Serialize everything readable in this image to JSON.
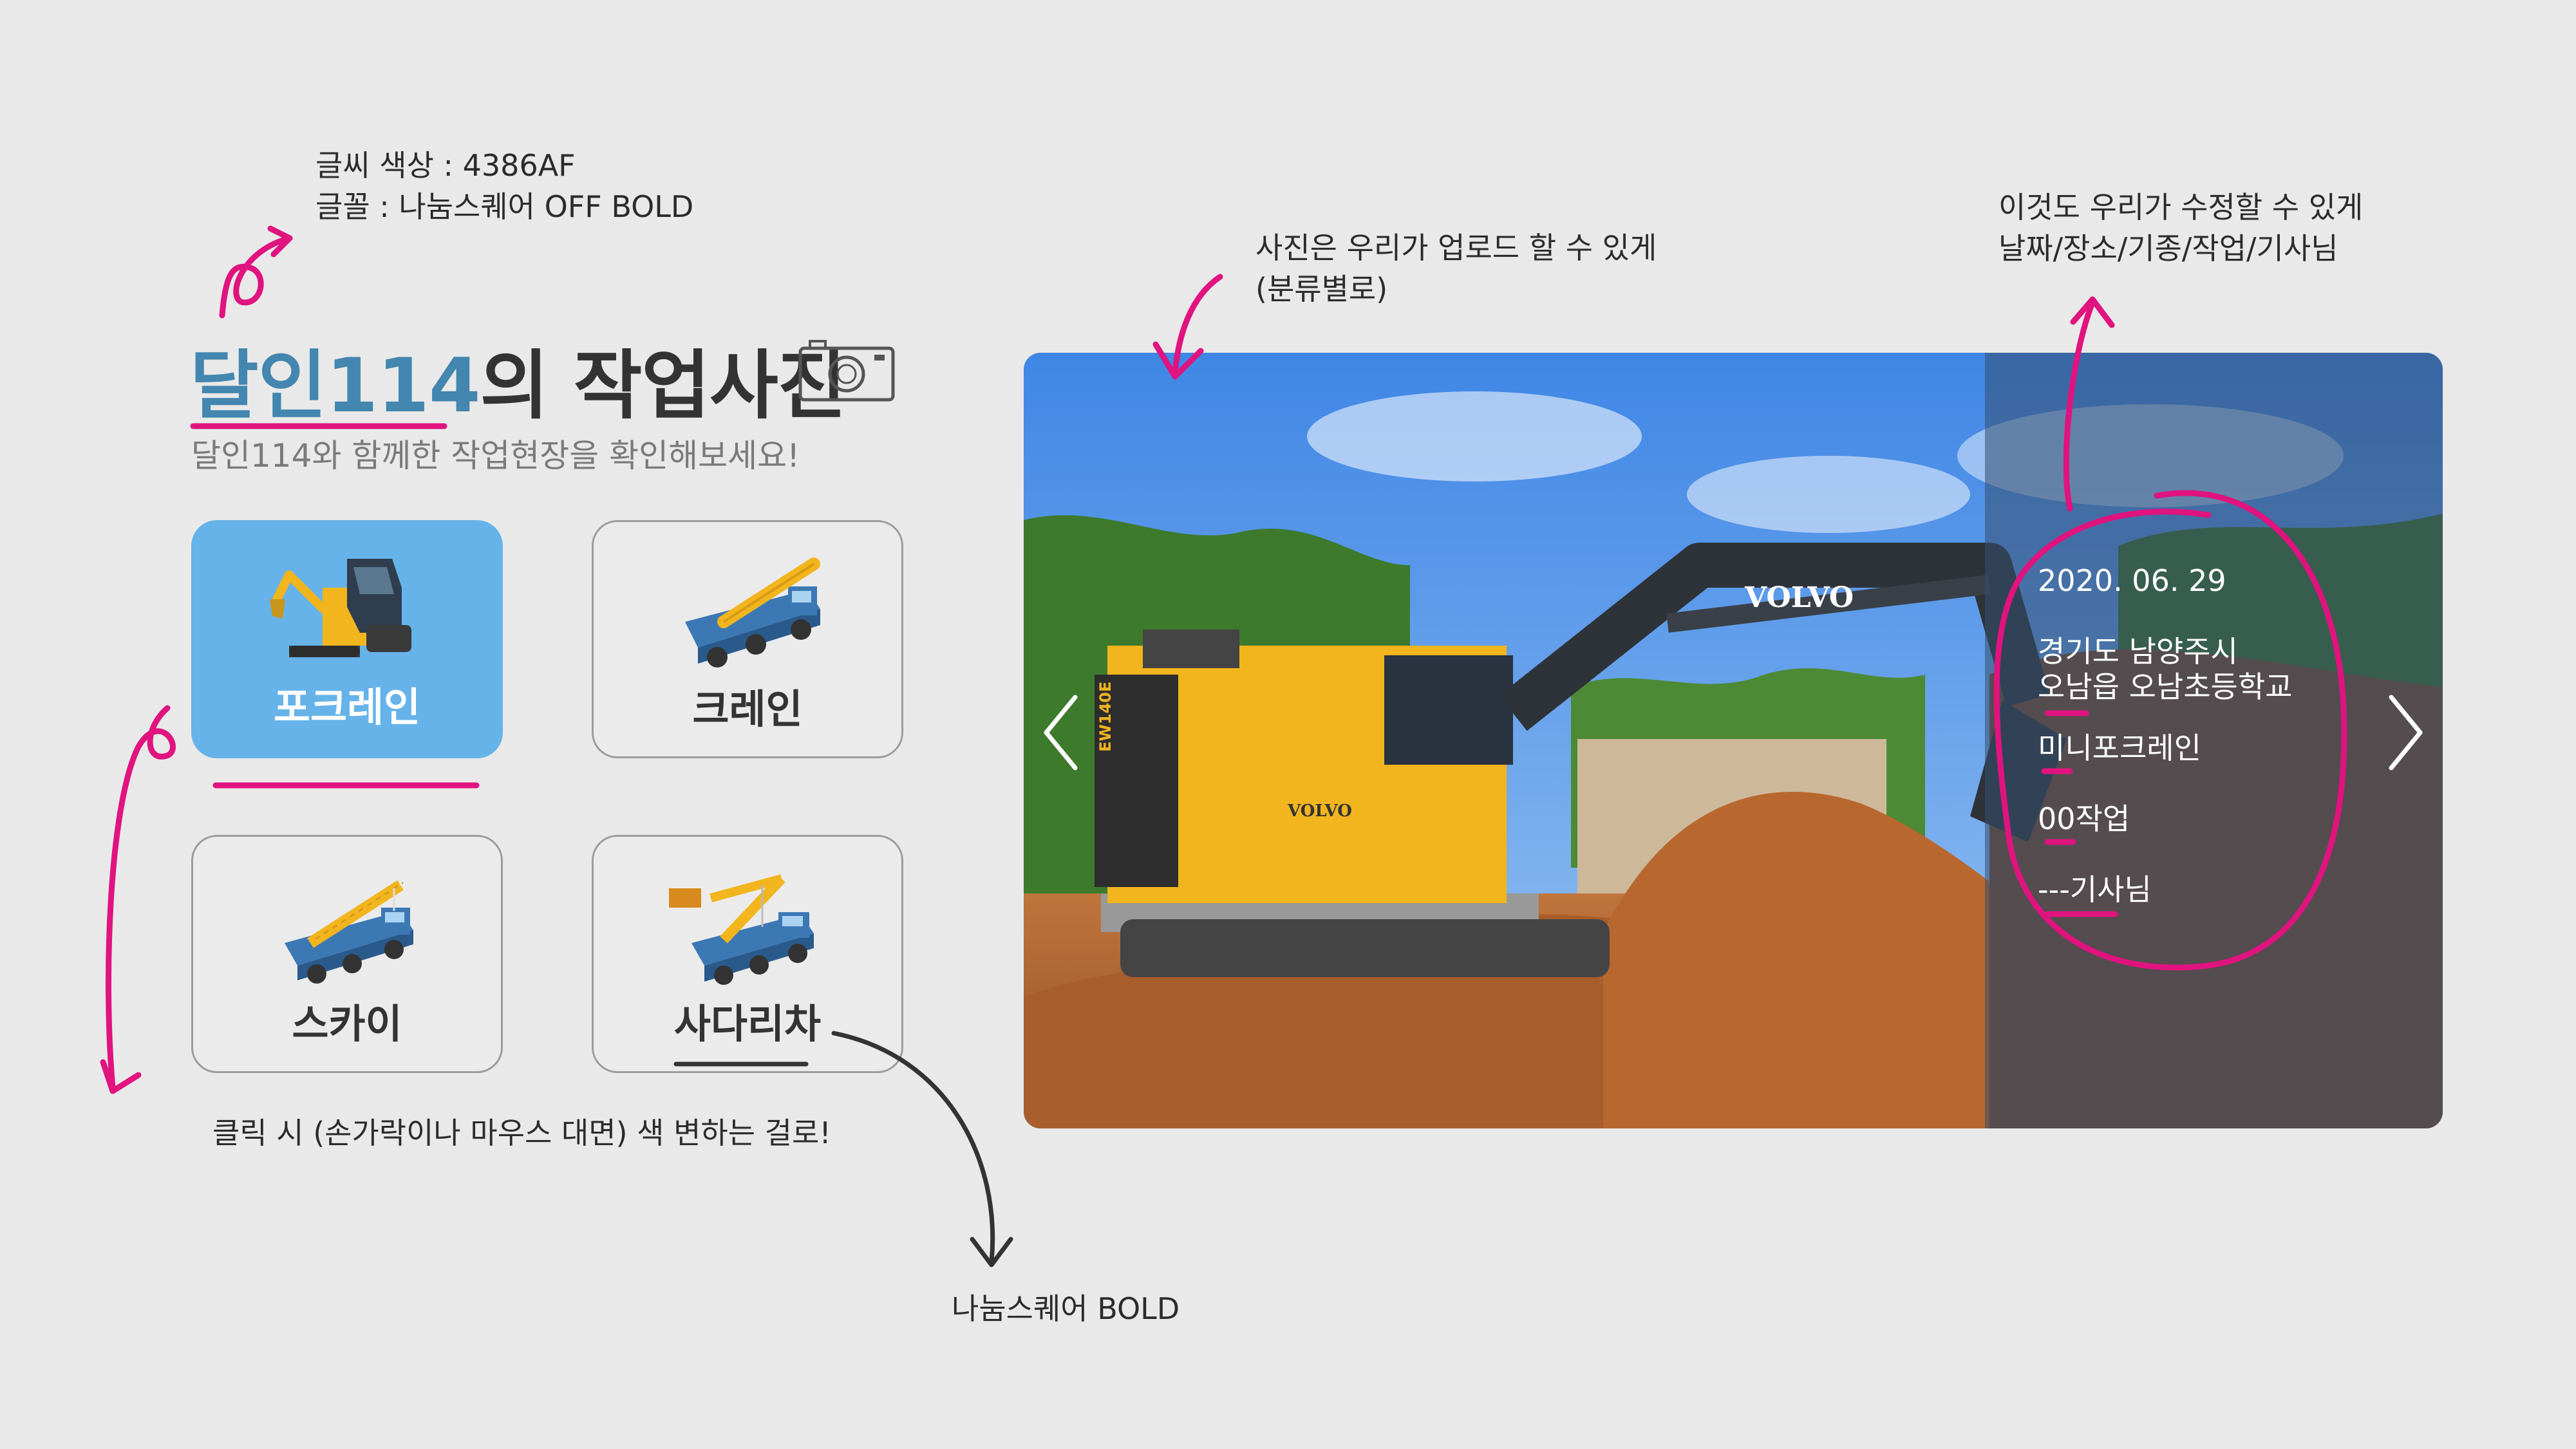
{
  "notes": {
    "font_color_line": "글씨 색상 : 4386AF",
    "font_family_line": "글꼴 : 나눔스퀘어 OFF BOLD",
    "photo_upload_line1": "사진은 우리가 업로드 할 수 있게",
    "photo_upload_line2": "(분류별로)",
    "editable_line1": "이것도 우리가 수정할 수 있게",
    "editable_line2": "날짜/장소/기종/작업/기사님",
    "click_hint": "클릭 시 (손가락이나 마우스 대면) 색 변하는 걸로!",
    "button_font": "나눔스퀘어 BOLD"
  },
  "header": {
    "title_brand": "달인114",
    "title_rest": "의 작업사진",
    "subtitle": "달인114와 함께한 작업현장을 확인해보세요!",
    "camera_icon": "camera-icon"
  },
  "categories": [
    {
      "label": "포크레인",
      "icon": "excavator-icon",
      "active": true
    },
    {
      "label": "크레인",
      "icon": "crane-truck-icon",
      "active": false
    },
    {
      "label": "스카이",
      "icon": "sky-lift-truck-icon",
      "active": false
    },
    {
      "label": "사다리차",
      "icon": "ladder-truck-icon",
      "active": false
    }
  ],
  "slider": {
    "photo_brand_arm": "VOLVO",
    "photo_brand_body": "VOLVO",
    "photo_model": "EW140E",
    "date": "2020. 06. 29",
    "location_line1": "경기도 남양주시",
    "location_line2": "오남읍 오남초등학교",
    "equipment": "미니포크레인",
    "job": "00작업",
    "driver": "---기사님",
    "prev_icon": "chevron-left-icon",
    "next_icon": "chevron-right-icon"
  },
  "colors": {
    "brand": "#4386AF",
    "active_card": "#66b3ea",
    "annotation_pink": "#e0137f",
    "background": "#e9e9e9"
  }
}
